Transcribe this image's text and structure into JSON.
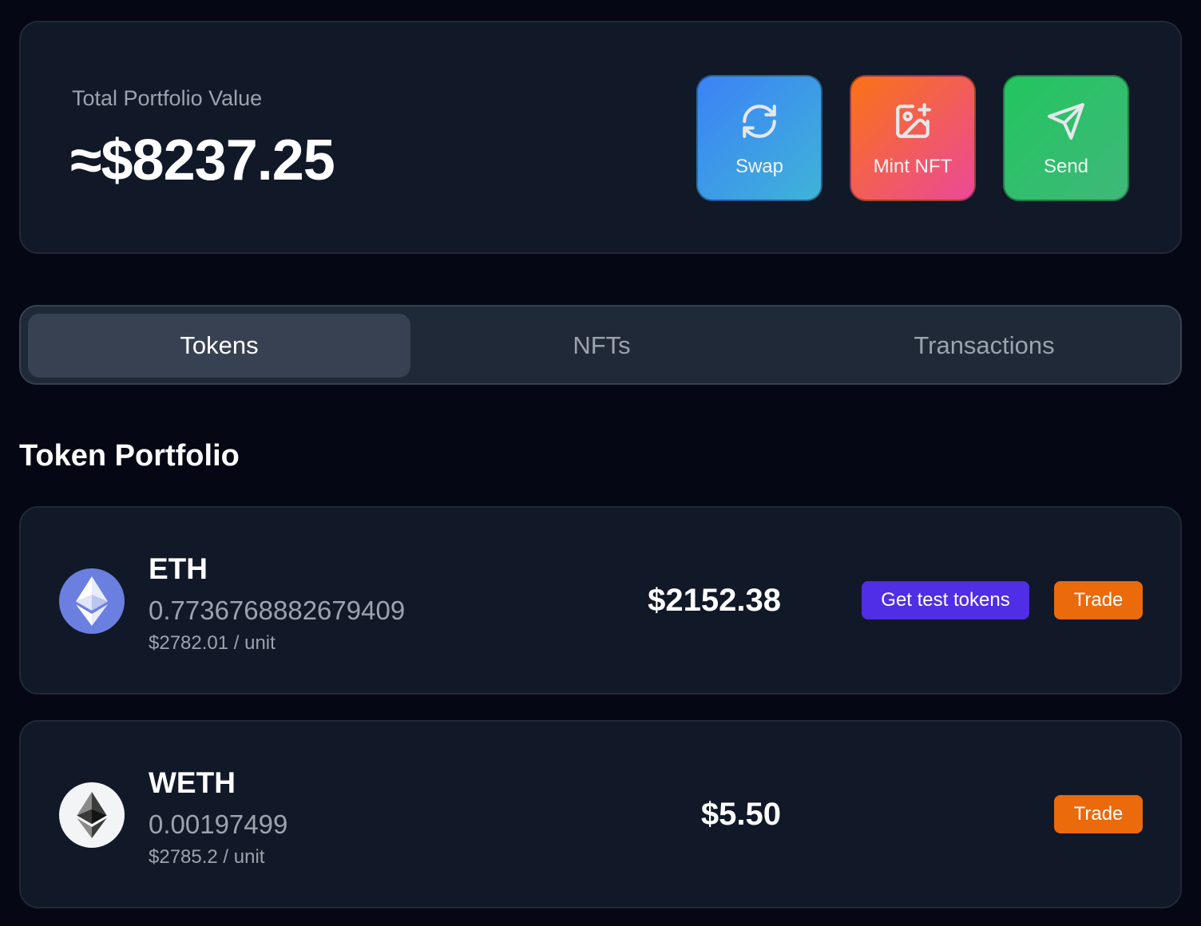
{
  "portfolio": {
    "label": "Total Portfolio Value",
    "value": "≈$8237.25"
  },
  "actions": [
    {
      "label": "Swap",
      "icon": "refresh-icon",
      "gradient": [
        "#3b82f6",
        "#3fb3d8"
      ]
    },
    {
      "label": "Mint NFT",
      "icon": "image-plus-icon",
      "gradient": [
        "#f97316",
        "#ec4899"
      ]
    },
    {
      "label": "Send",
      "icon": "send-icon",
      "gradient": [
        "#22c55e",
        "#3fb87a"
      ]
    }
  ],
  "tabs": [
    {
      "label": "Tokens",
      "active": true
    },
    {
      "label": "NFTs",
      "active": false
    },
    {
      "label": "Transactions",
      "active": false
    }
  ],
  "section_title": "Token Portfolio",
  "tokens": [
    {
      "symbol": "ETH",
      "icon": "ethereum-icon",
      "amount": "0.7736768882679409",
      "unit_price": "$2782.01 / unit",
      "usd_value": "$2152.38",
      "faucet_label": "Get test tokens",
      "trade_label": "Trade"
    },
    {
      "symbol": "WETH",
      "icon": "weth-icon",
      "amount": "0.00197499",
      "unit_price": "$2785.2 / unit",
      "usd_value": "$5.50",
      "trade_label": "Trade"
    }
  ],
  "colors": {
    "background": "#050814",
    "card": "#111827",
    "faucet_button": "#4f2ee5",
    "trade_button": "#ea6a0c"
  }
}
